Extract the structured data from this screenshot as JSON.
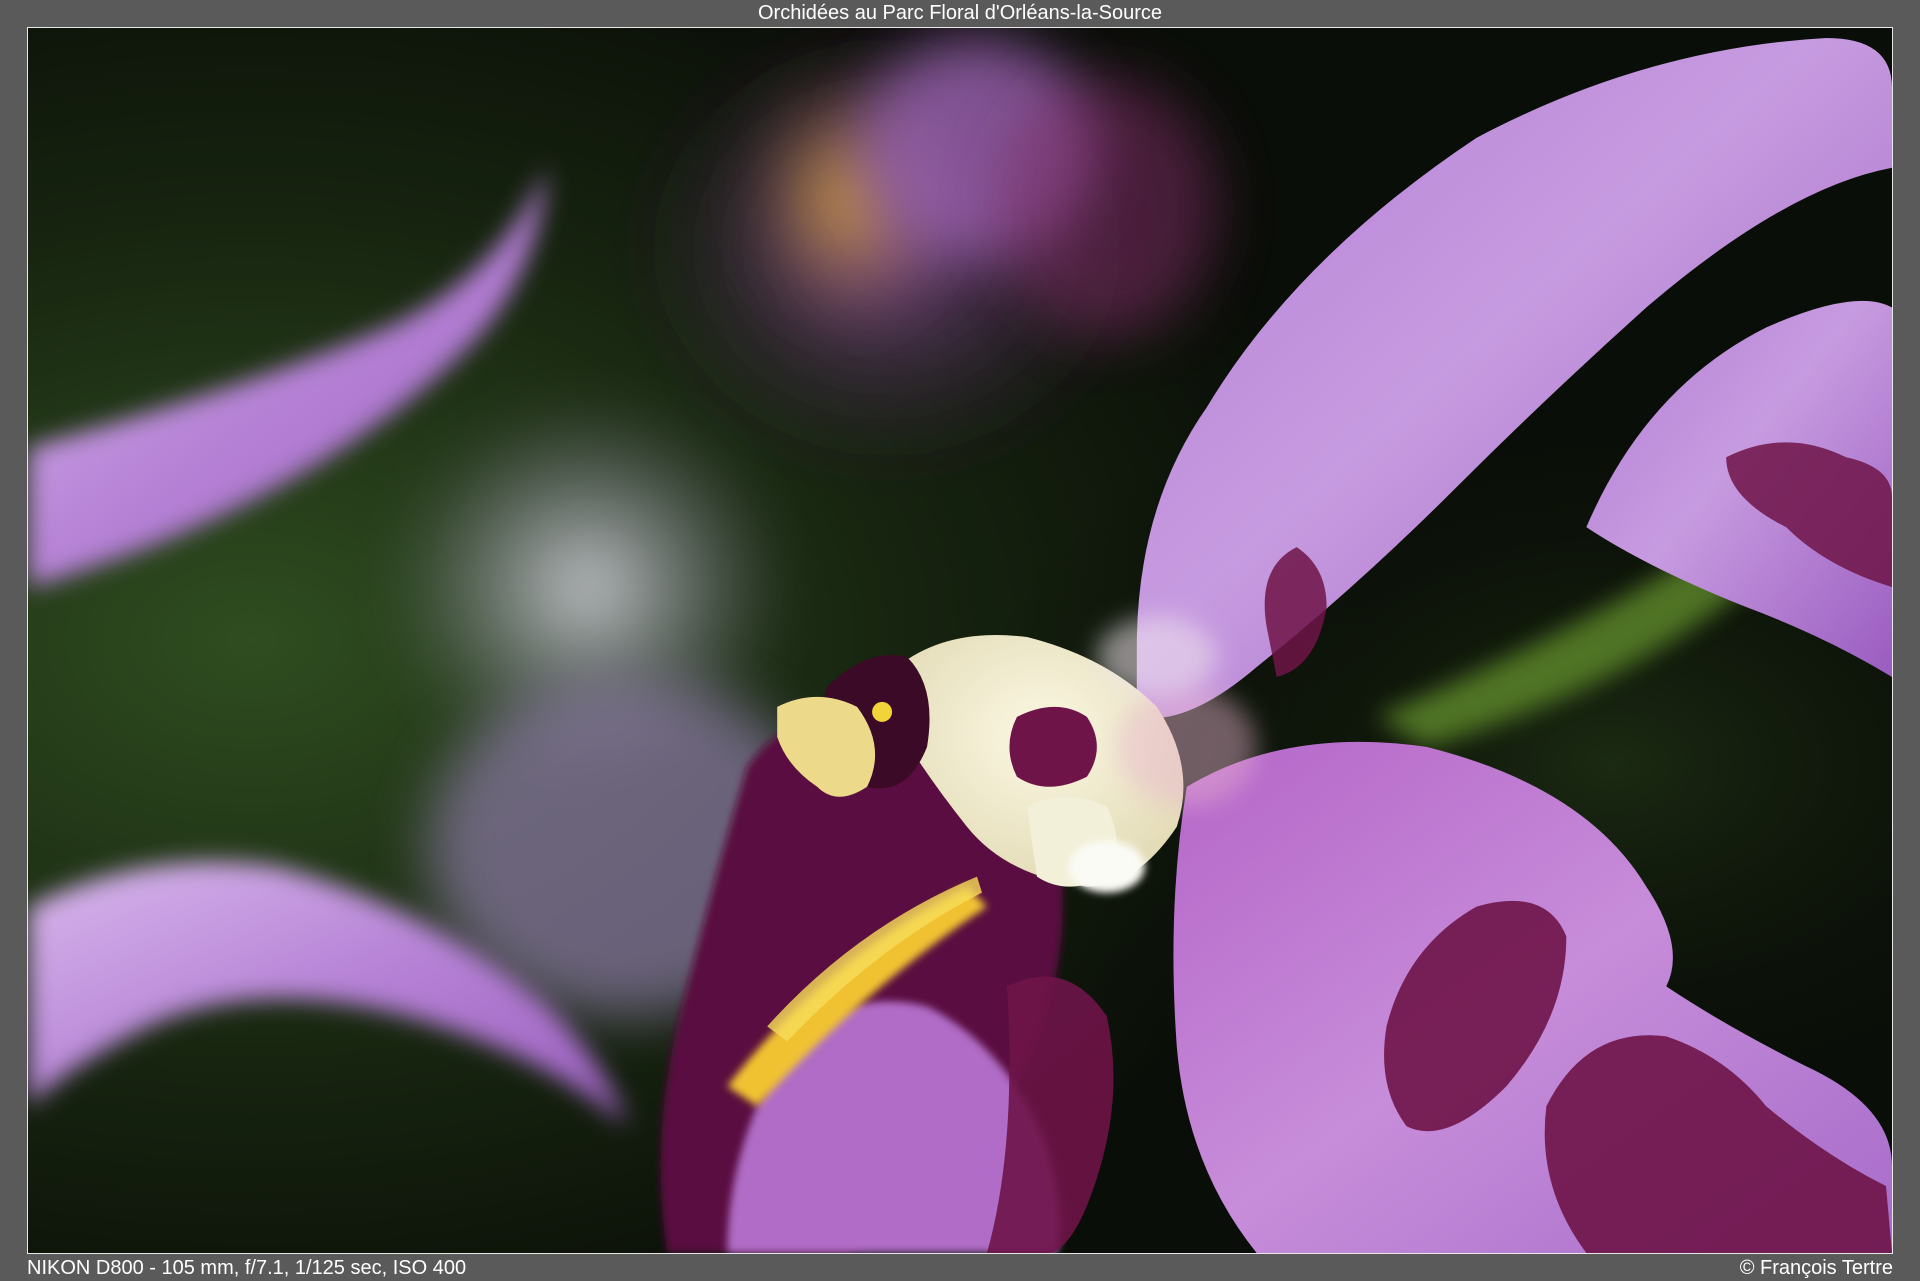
{
  "title": "Orchidées au Parc Floral d'Orléans-la-Source",
  "camera_info": "NIKON D800 - 105 mm, f/7.1, 1/125 sec, ISO 400",
  "copyright": "© François Tertre",
  "colors": {
    "frame": "#5a5a5a",
    "petal_light": "#c9a3e0",
    "petal_mid": "#a46cc6",
    "petal_dark_spot": "#6e1448",
    "column_cream": "#f1efcf",
    "pollen_yellow": "#f2d43a",
    "background_dark": "#0d120a",
    "background_green": "#2c4a1e"
  }
}
